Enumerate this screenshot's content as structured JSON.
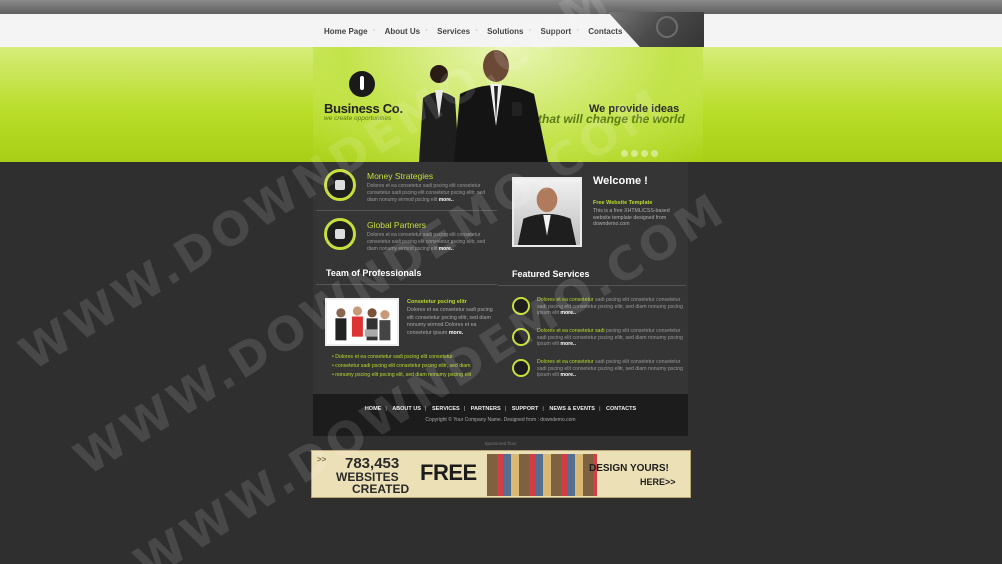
{
  "nav": {
    "items": [
      "Home Page",
      "About Us",
      "Services",
      "Solutions",
      "Support",
      "Contacts"
    ]
  },
  "banner": {
    "logo": "Business Co.",
    "logo_sub": "we create opportunities",
    "tagline_1": "We provide ideas",
    "tagline_2": "that will change the world"
  },
  "features": [
    {
      "title": "Money Strategies",
      "text": "Dolores et ea consetetur sadi pscing elit consetetur consetetur sadi pscing elit consetetur pscing elitr, sed diam nonumy eirmod pscing elit",
      "more": "more.."
    },
    {
      "title": "Global Partners",
      "text": "Dolores et ea consetetur sadi pscing elit consetetur consetetur sadi pscing elit consetetur pscing elitr, sed diam nonumy eirmod pscing elit",
      "more": "more.."
    }
  ],
  "welcome": {
    "title": "Welcome !",
    "subtitle": "Free Website Template",
    "text": "This is a free XHTML/CSS-based website template designed from downdemo.com"
  },
  "team": {
    "heading": "Team of Professionals",
    "title": "Consetetur pscing elitr",
    "text": "Dolores et ea consetetur sadi pscing elit consetetur pscing elitr, sed diam nonumy eirmod Dolores et ea consetetur ipsum",
    "more": "more.",
    "list": [
      "Dolores et ea consetetur sadi pscing elit consetetur",
      "consetetur sadi pscing elit consetetur pscing elitr, sed diam",
      "nonumy pscing elit pscing elit, sed diam nonumy pscing elit"
    ]
  },
  "services": {
    "heading": "Featured Services",
    "items": [
      {
        "lead": "Dolores et ea consetetur",
        "text": "sadi pscing elit consetetur consetetur sadi pscing elit consetetur pscing elitr, sed diam nonumy pscing ipsum elit",
        "more": "more.."
      },
      {
        "lead": "Dolores et ea consetetur sadi",
        "text": "pscing elit consetetur consetetur sadi pscing elit consetetur pscing elitr, sed diam nonumy pscing ipsum elit",
        "more": "more.."
      },
      {
        "lead": "Dolores et ea consetetur",
        "text": "sadi pscing elit consetetur consetetur sadi pscing elit consetetur pscing elitr, sed diam nonumy pscing ipsum elit",
        "more": "more.."
      }
    ]
  },
  "footer": {
    "links": [
      "HOME",
      "ABOUT US",
      "SERVICES",
      "PARTNERS",
      "SUPPORT",
      "NEWS & EVENTS",
      "CONTACTS"
    ],
    "copyright": "Copyright © Your Company Name. Designed from : downdemo.com",
    "sponsored": "Sponsored from"
  },
  "ad": {
    "arrows": ">>",
    "number": "783,453",
    "line1": "WEBSITES",
    "line2": "CREATED",
    "free": "FREE",
    "design": "DESIGN YOURS!",
    "here": "HERE>>"
  },
  "watermark": "WWW.DOWNDEMO.COM",
  "colors": {
    "accent_green": "#b9dc2c",
    "background": "#2f2f2f"
  }
}
